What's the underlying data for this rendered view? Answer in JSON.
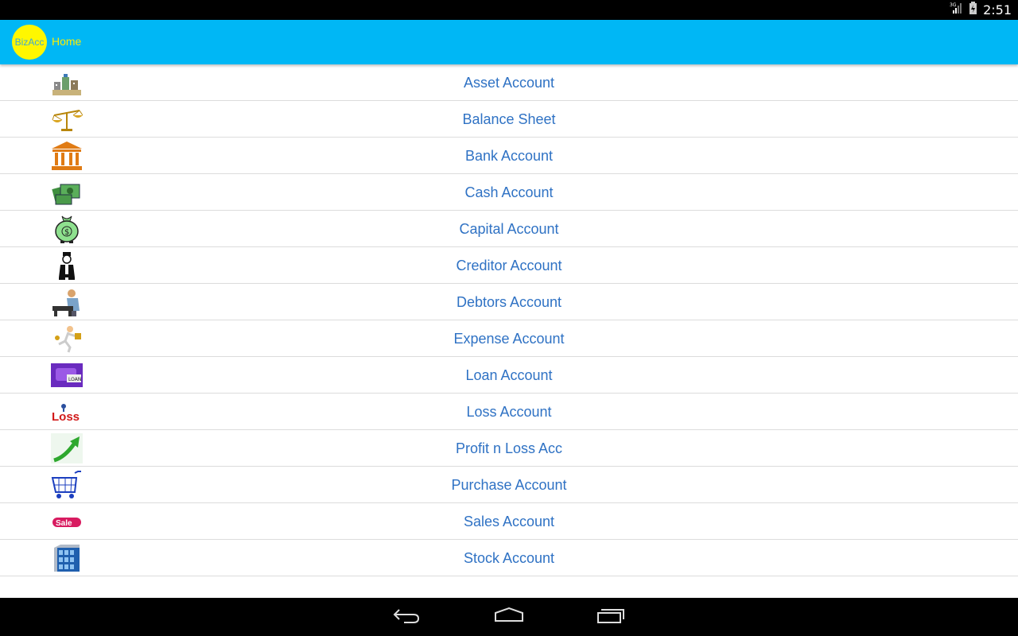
{
  "status_bar": {
    "network": "3G",
    "time": "2:51"
  },
  "app_bar": {
    "logo_text": "BizAcc",
    "title": "Home"
  },
  "accounts": [
    {
      "label": "Asset Account",
      "icon": "asset-icon"
    },
    {
      "label": "Balance Sheet",
      "icon": "scales-icon"
    },
    {
      "label": "Bank Account",
      "icon": "bank-icon"
    },
    {
      "label": "Cash Account",
      "icon": "cash-icon"
    },
    {
      "label": "Capital Account",
      "icon": "money-bag-icon"
    },
    {
      "label": "Creditor Account",
      "icon": "creditor-icon"
    },
    {
      "label": "Debtors Account",
      "icon": "debtor-icon"
    },
    {
      "label": "Expense Account",
      "icon": "expense-icon"
    },
    {
      "label": "Loan Account",
      "icon": "loan-icon"
    },
    {
      "label": "Loss Account",
      "icon": "loss-icon"
    },
    {
      "label": "Profit n Loss Acc",
      "icon": "profit-arrow-icon"
    },
    {
      "label": "Purchase Account",
      "icon": "shopping-cart-icon"
    },
    {
      "label": "Sales Account",
      "icon": "sale-icon"
    },
    {
      "label": "Stock Account",
      "icon": "stock-building-icon"
    }
  ],
  "icon_text": {
    "loan": "LOAN",
    "loss": "Loss",
    "sale": "Sale"
  },
  "colors": {
    "app_bar": "#00b7f5",
    "title": "#ffee00",
    "logo": "#fff700",
    "list_text": "#2f72c4",
    "divider": "#dcdcdc"
  }
}
